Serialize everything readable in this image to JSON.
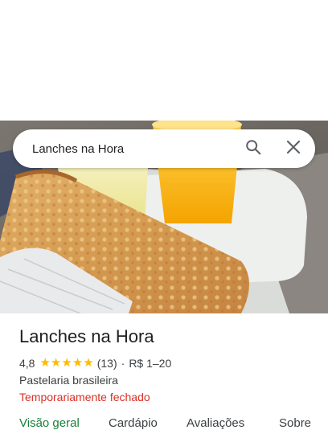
{
  "search": {
    "query": "Lanches na Hora"
  },
  "icons": {
    "search": "search-icon",
    "close": "close-icon"
  },
  "place": {
    "name": "Lanches na Hora",
    "rating": "4,8",
    "stars_filled": 5,
    "review_count": "(13)",
    "separator": "·",
    "price": "R$ 1–20",
    "category": "Pastelaria brasileira",
    "status": "Temporariamente fechado"
  },
  "tabs": [
    {
      "label": "Visão geral",
      "active": true
    },
    {
      "label": "Cardápio",
      "active": false
    },
    {
      "label": "Avaliações",
      "active": false
    },
    {
      "label": "Sobre",
      "active": false
    }
  ],
  "colors": {
    "status_closed": "#d93025",
    "star": "#fbbc04",
    "active_tab": "#188038"
  }
}
